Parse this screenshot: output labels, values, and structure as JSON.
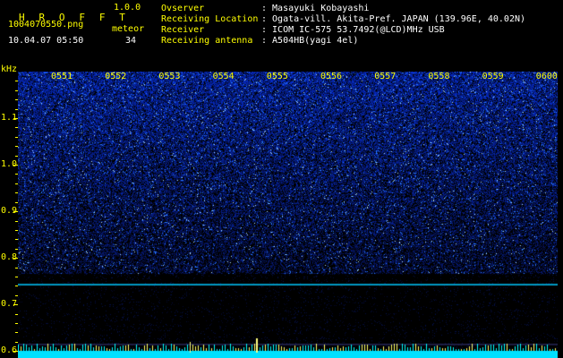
{
  "header": {
    "title": "H R O F F T",
    "version": "1.0.0",
    "filename": "1004070550.png",
    "datetime": "10.04.07 05:50",
    "counter_label": "meteor",
    "counter_value": "34",
    "info": [
      {
        "label": "Ovserver",
        "value": ": Masayuki Kobayashi"
      },
      {
        "label": "Receiving Location",
        "value": ": Ogata-vill. Akita-Pref. JAPAN (139.96E, 40.02N)"
      },
      {
        "label": "Receiver",
        "value": ": ICOM IC-575 53.7492(@LCD)MHz USB"
      },
      {
        "label": "Receiving antenna",
        "value": ": A504HB(yagi 4el)"
      }
    ]
  },
  "spectrogram": {
    "y_unit": "kHz",
    "y_labels": [
      "1.1",
      "1.0",
      "0.9",
      "0.8",
      "0.7",
      "0.6"
    ],
    "y_values": [
      1.1,
      1.0,
      0.9,
      0.8,
      0.7,
      0.6
    ],
    "y_range": [
      0.585,
      1.2
    ],
    "time_labels": [
      "0551",
      "0552",
      "0553",
      "0554",
      "0555",
      "0556",
      "0557",
      "0558",
      "0559",
      "0600"
    ],
    "colors": {
      "signal": "#1428c8",
      "text": "#ffff00",
      "carrier": "#00c8ff",
      "bottom": "#00e0ff"
    }
  }
}
